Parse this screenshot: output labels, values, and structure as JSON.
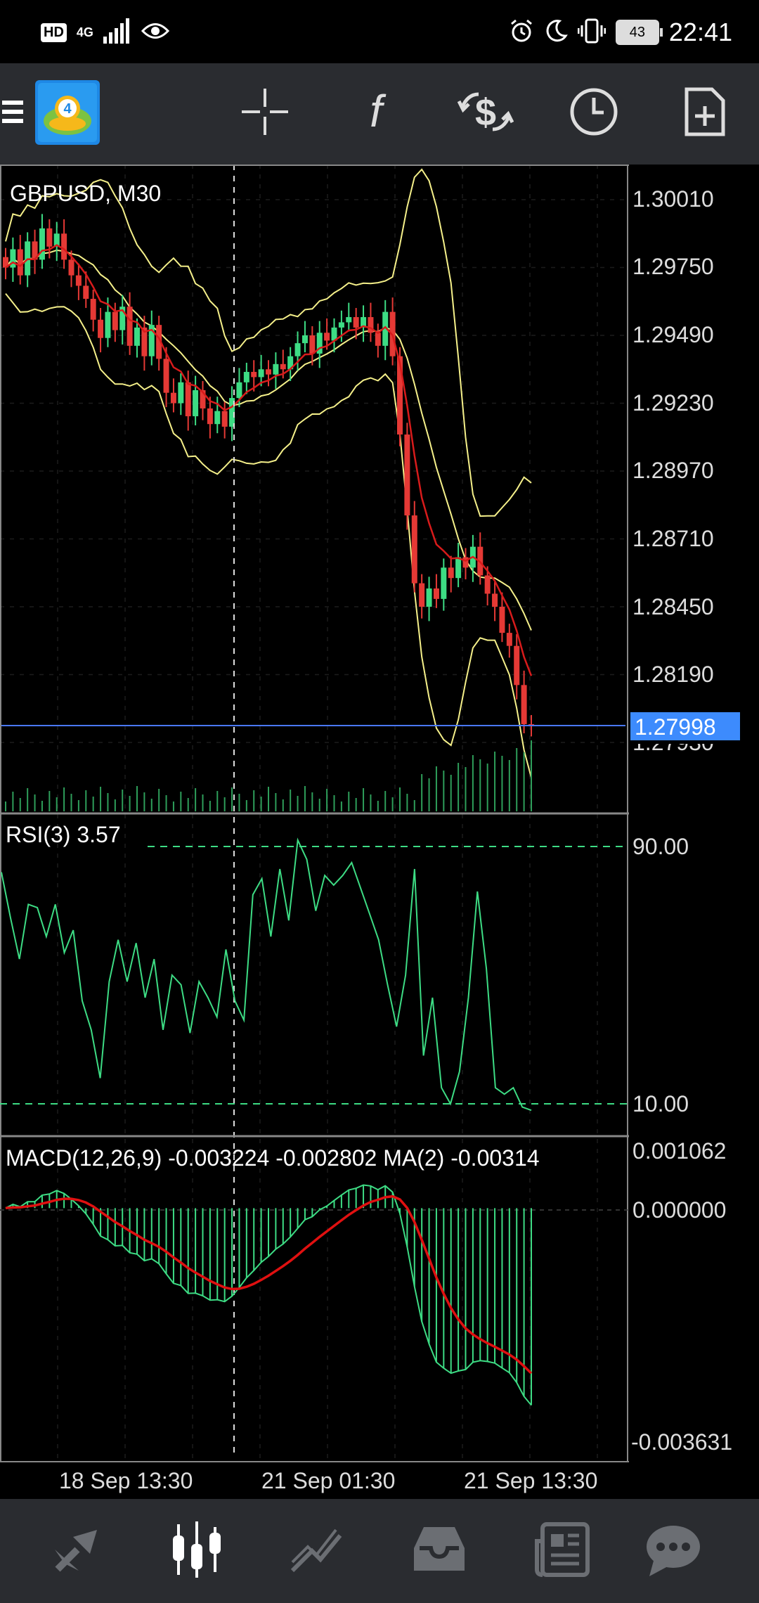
{
  "status_bar": {
    "network_badge": "HD",
    "network_type": "4G",
    "battery_level": "43",
    "time": "22:41"
  },
  "toolbar": {
    "icons": [
      "menu-icon",
      "metatrader-logo-icon",
      "crosshair-icon",
      "function-icon",
      "currency-exchange-icon",
      "clock-icon",
      "new-document-icon"
    ]
  },
  "chart": {
    "symbol_label": "GBPUSD, M30",
    "current_price": "1.27998",
    "price_scale": [
      "1.30010",
      "1.29750",
      "1.29490",
      "1.29230",
      "1.28970",
      "1.28710",
      "1.28450",
      "1.28190",
      "1.27930"
    ],
    "time_labels": [
      "18 Sep 13:30",
      "21 Sep 01:30",
      "21 Sep 13:30"
    ],
    "rsi": {
      "label": "RSI(3) 3.57",
      "levels": [
        "90.00",
        "10.00"
      ]
    },
    "macd": {
      "label": "MACD(12,26,9) -0.003224 -0.002802 MA(2) -0.00314",
      "scale": [
        "0.001062",
        "0.000000",
        "-0.003631"
      ]
    },
    "colors": {
      "bull": "#3ddc84",
      "bear": "#e53935",
      "bollinger": "#f5f08a",
      "ma": "#d81b1b",
      "bid_line": "#4a78ff",
      "price_tag": "#3d8bfd",
      "indicator": "#3ddc84",
      "macd_signal": "#e01010"
    }
  },
  "chart_data": {
    "type": "candlestick",
    "symbol": "GBPUSD",
    "timeframe": "M30",
    "last_price": 1.27998,
    "y_ticks": [
      1.3001,
      1.2975,
      1.2949,
      1.2923,
      1.2897,
      1.2871,
      1.2845,
      1.2819,
      1.2793
    ],
    "x_tick_labels": [
      "18 Sep 13:30",
      "21 Sep 01:30",
      "21 Sep 13:30"
    ],
    "close": [
      1.2975,
      1.2982,
      1.2972,
      1.2985,
      1.2978,
      1.299,
      1.2983,
      1.2988,
      1.2978,
      1.2972,
      1.2968,
      1.2963,
      1.2955,
      1.2948,
      1.2958,
      1.2951,
      1.296,
      1.2945,
      1.2952,
      1.2941,
      1.2953,
      1.294,
      1.2927,
      1.2923,
      1.2931,
      1.2918,
      1.2928,
      1.2921,
      1.2915,
      1.292,
      1.2914,
      1.2925,
      1.2931,
      1.2935,
      1.2933,
      1.2936,
      1.2934,
      1.2938,
      1.2936,
      1.2941,
      1.2946,
      1.2949,
      1.2942,
      1.295,
      1.2947,
      1.2952,
      1.2954,
      1.2956,
      1.2952,
      1.2956,
      1.295,
      1.2945,
      1.2958,
      1.2941,
      1.2911,
      1.288,
      1.2854,
      1.2845,
      1.2852,
      1.2848,
      1.286,
      1.2856,
      1.2864,
      1.286,
      1.2868,
      1.2857,
      1.285,
      1.2845,
      1.2835,
      1.283,
      1.2815,
      1.28,
      1.27998
    ],
    "rsi": [
      82,
      68,
      55,
      72,
      71,
      62,
      72,
      57,
      64,
      42,
      33,
      18,
      48,
      61,
      48,
      60,
      43,
      55,
      33,
      50,
      47,
      32,
      48,
      43,
      37,
      58,
      42,
      36,
      75,
      80,
      62,
      83,
      67,
      92,
      86,
      70,
      81,
      78,
      81,
      85,
      77,
      69,
      61,
      47,
      34,
      50,
      83,
      25,
      43,
      15,
      10,
      20,
      43,
      76,
      52,
      15,
      13,
      15,
      9,
      8
    ],
    "rsi_levels": [
      90,
      10
    ],
    "macd_range": [
      -0.003631,
      0.001062
    ],
    "macd_last": -0.003224,
    "signal_last": -0.002802
  }
}
